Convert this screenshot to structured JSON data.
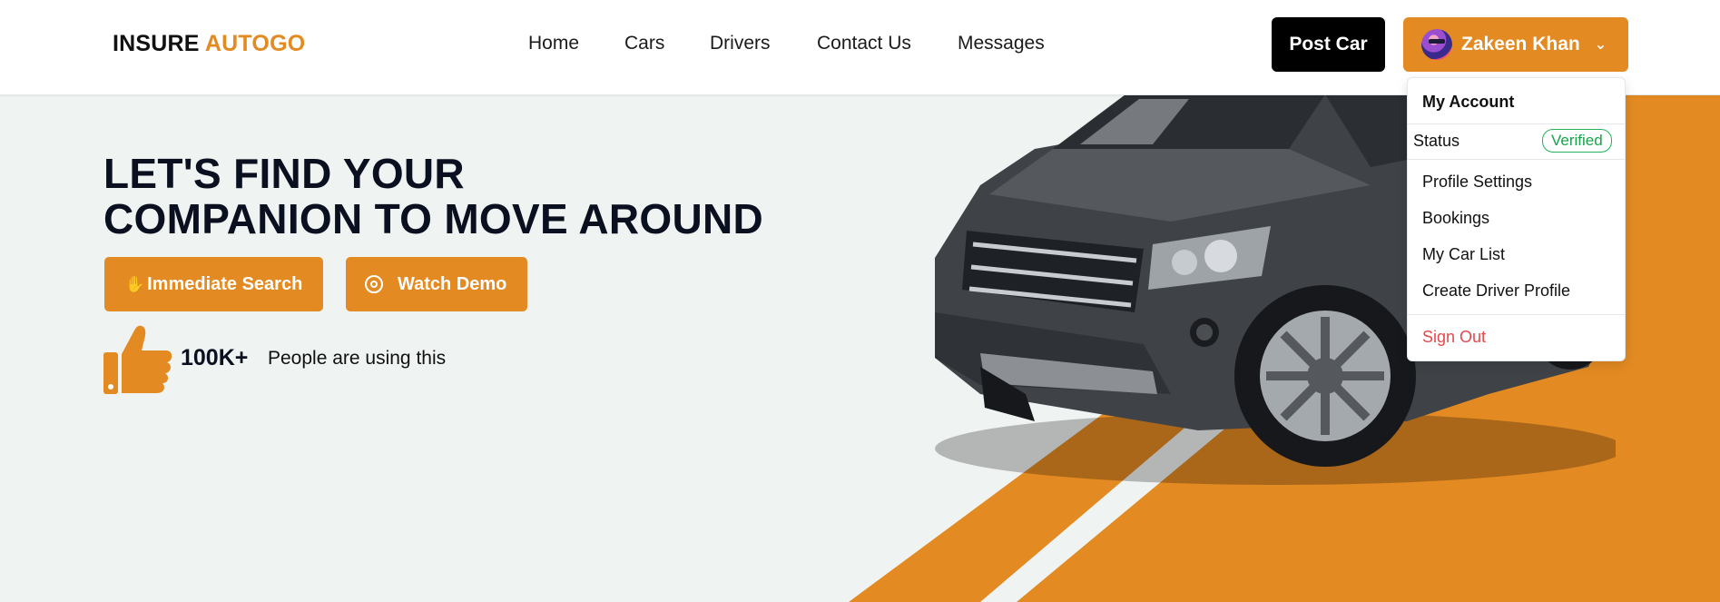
{
  "header": {
    "logo_part1": "INSURE",
    "logo_part2": "AUTOGO",
    "nav": [
      "Home",
      "Cars",
      "Drivers",
      "Contact Us",
      "Messages"
    ],
    "post_button": "Post Car",
    "user_name": "Zakeen Khan",
    "icons": {
      "user": "avatar",
      "dropdown": "chevron-down-icon"
    }
  },
  "hero": {
    "title_line1": "LET'S FIND YOUR",
    "title_line2": "COMPANION TO MOVE AROUND",
    "search_button": "Immediate Search",
    "demo_button": "Watch Demo",
    "stat_value": "100K+",
    "stat_text": "People are using this",
    "icons": {
      "search": "hand-icon",
      "demo": "target-icon",
      "stat": "thumbs-up-icon"
    }
  },
  "dropdown": {
    "heading": "My Account",
    "status_label": "Status",
    "status_value": "Verified",
    "items": [
      "Profile Settings",
      "Bookings",
      "My Car List",
      "Create Driver Profile"
    ],
    "sign_out": "Sign Out"
  },
  "colors": {
    "accent": "#e38a22",
    "background": "#eff3f1",
    "verified": "#17a34a",
    "sign_out": "#e5484d"
  }
}
